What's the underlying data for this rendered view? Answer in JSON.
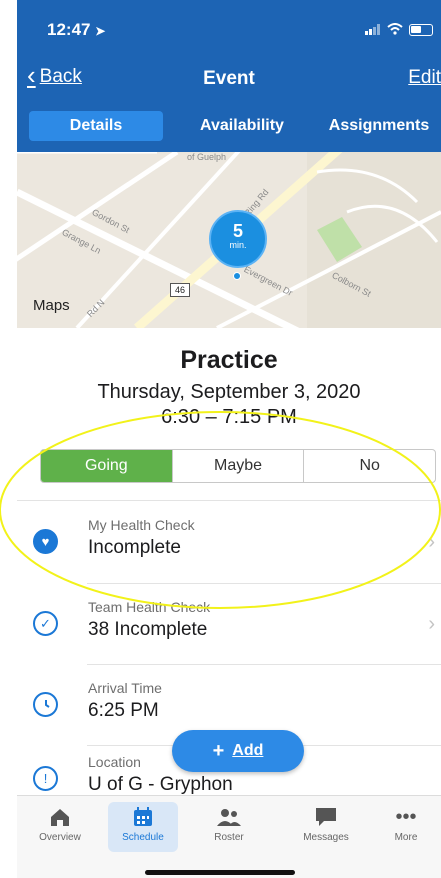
{
  "status_bar": {
    "time": "12:47",
    "location_arrow": "location-arrow-icon"
  },
  "nav": {
    "back_label": "Back",
    "title": "Event",
    "edit_label": "Edit"
  },
  "tabs": [
    {
      "label": "Details",
      "active": true
    },
    {
      "label": "Availability",
      "active": false
    },
    {
      "label": "Assignments",
      "active": false
    }
  ],
  "map": {
    "pin_value": "5",
    "pin_unit": "min.",
    "attribution": "Maps",
    "highway_shield": "46",
    "road_labels": [
      "Gordon St",
      "Grange Ln",
      "Ring Rd",
      "Evergreen Dr",
      "Colborn St",
      "of Guelph",
      "Rd N"
    ]
  },
  "event": {
    "title": "Practice",
    "date": "Thursday, September 3, 2020",
    "time": "6:30 – 7:15 PM"
  },
  "rsvp": {
    "options": [
      "Going",
      "Maybe",
      "No"
    ],
    "selected": "Going"
  },
  "details": [
    {
      "label": "My Health Check",
      "value": "Incomplete",
      "icon": "heart-icon",
      "chevron": true
    },
    {
      "label": "Team Health Check",
      "value": "38 Incomplete",
      "icon": "check-circle-icon",
      "chevron": true
    },
    {
      "label": "Arrival Time",
      "value": "6:25 PM",
      "icon": "clock-icon",
      "chevron": false
    },
    {
      "label": "Location",
      "value": "U of G - Gryphon",
      "icon": "location-info-icon",
      "chevron": false
    }
  ],
  "add_button": {
    "label": "Add"
  },
  "tabbar": [
    {
      "label": "Overview",
      "icon": "home-icon",
      "active": false
    },
    {
      "label": "Schedule",
      "icon": "calendar-icon",
      "active": true
    },
    {
      "label": "Roster",
      "icon": "people-icon",
      "active": false
    },
    {
      "label": "Messages",
      "icon": "chat-bubble-icon",
      "active": false
    },
    {
      "label": "More",
      "icon": "more-dots-icon",
      "active": false
    }
  ],
  "colors": {
    "header_blue": "#1d64b4",
    "tab_active": "#2d8ae6",
    "going_green": "#5fb14a",
    "icon_blue": "#1b78d6",
    "annotation_yellow": "#f2f21a"
  }
}
